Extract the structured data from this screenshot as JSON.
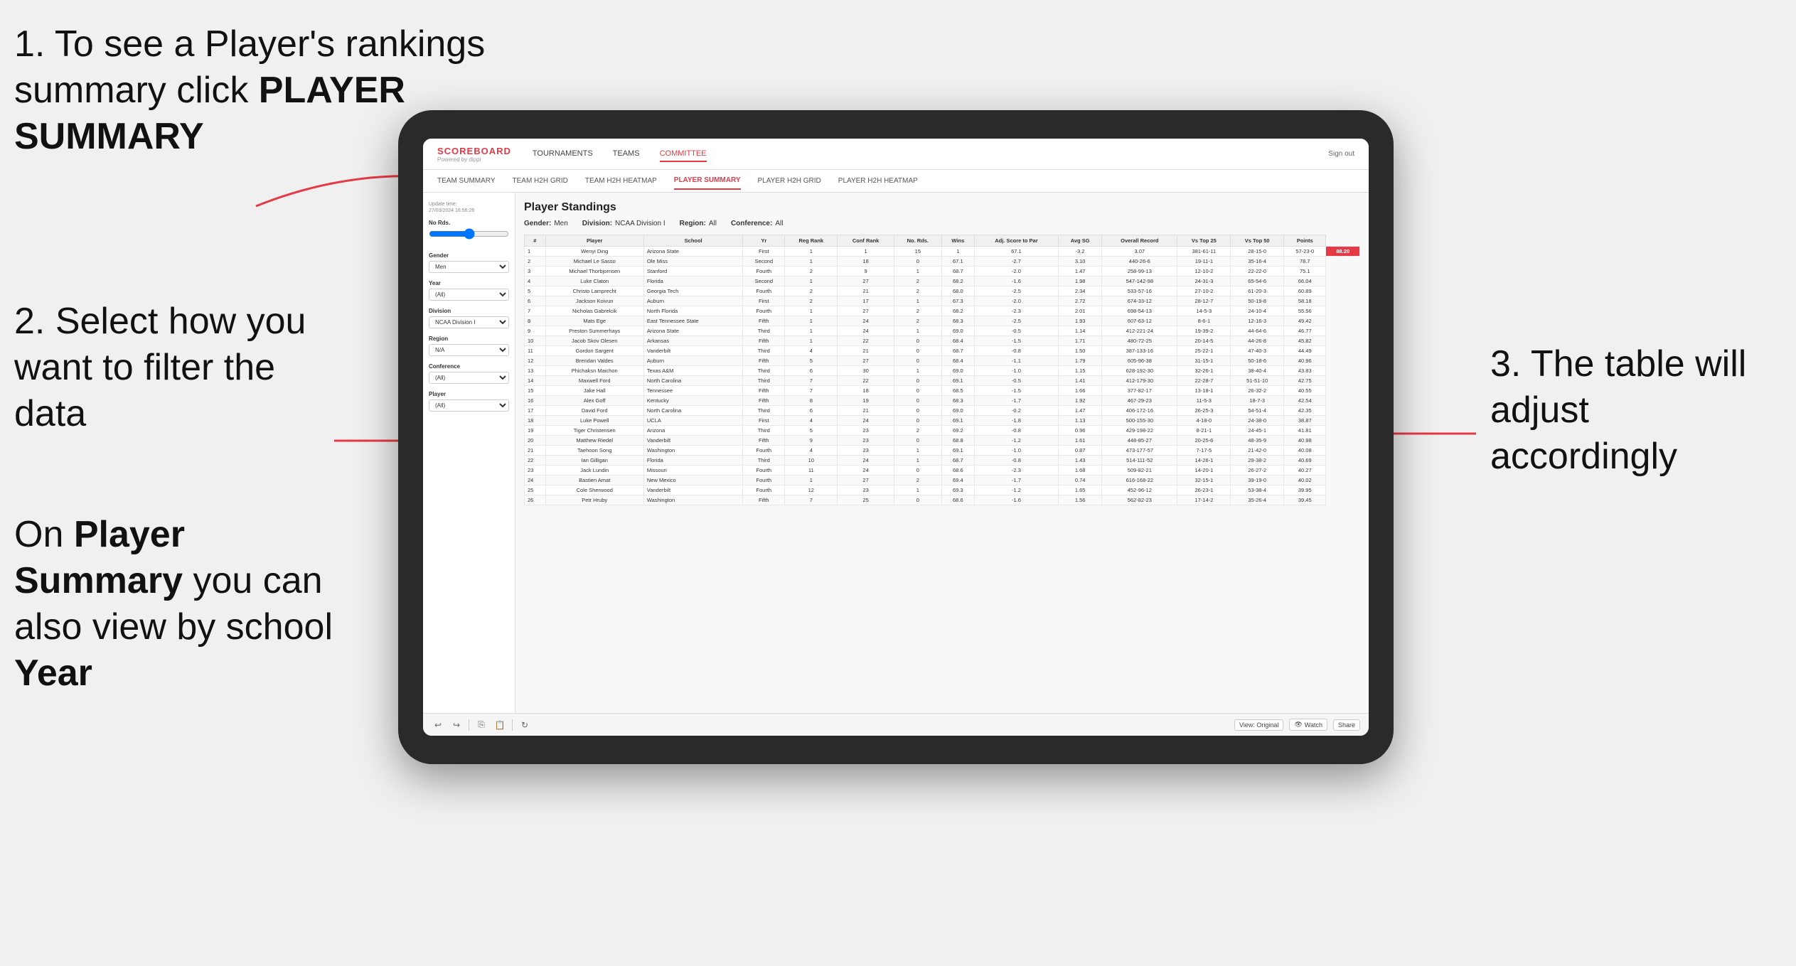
{
  "annotations": {
    "top_left_line1": "1. To see a Player's rankings",
    "top_left_line2": "summary click ",
    "top_left_bold": "PLAYER SUMMARY",
    "mid_left": "2. Select how you want to filter the data",
    "bottom_left_line1": "On ",
    "bottom_left_bold1": "Player Summary",
    "bottom_left_line2": " you can also view by school ",
    "bottom_left_bold2": "Year",
    "right_text": "3. The table will adjust accordingly"
  },
  "nav": {
    "logo": "SCOREBOARD",
    "logo_sub": "Powered by dippi",
    "items": [
      "TOURNAMENTS",
      "TEAMS",
      "COMMITTEE"
    ],
    "right": [
      "Sign out"
    ],
    "sub_items": [
      "TEAM SUMMARY",
      "TEAM H2H GRID",
      "TEAM H2H HEATMAP",
      "PLAYER SUMMARY",
      "PLAYER H2H GRID",
      "PLAYER H2H HEATMAP"
    ]
  },
  "sidebar": {
    "update_label": "Update time:",
    "update_time": "27/03/2024 16:56:26",
    "no_rds_label": "No Rds.",
    "slider_label": "",
    "gender_label": "Gender",
    "gender_value": "Men",
    "year_label": "Year",
    "year_value": "(All)",
    "division_label": "Division",
    "division_value": "NCAA Division I",
    "region_label": "Region",
    "region_value": "N/A",
    "conference_label": "Conference",
    "conference_value": "(All)",
    "player_label": "Player",
    "player_value": "(All)"
  },
  "table": {
    "title": "Player Standings",
    "filters": {
      "gender_label": "Gender:",
      "gender_value": "Men",
      "division_label": "Division:",
      "division_value": "NCAA Division I",
      "region_label": "Region:",
      "region_value": "All",
      "conference_label": "Conference:",
      "conference_value": "All"
    },
    "columns": [
      "#",
      "Player",
      "School",
      "Yr",
      "Reg Rank",
      "Conf Rank",
      "No. Rds.",
      "Wins",
      "Adj. Score to Par",
      "Avg SG",
      "Overall Record",
      "Vs Top 25",
      "Vs Top 50",
      "Points"
    ],
    "rows": [
      [
        "1",
        "Wenyi Ding",
        "Arizona State",
        "First",
        "1",
        "1",
        "15",
        "1",
        "67.1",
        "-3.2",
        "3.07",
        "381-61-11",
        "28-15-0",
        "57-23-0",
        "88.20"
      ],
      [
        "2",
        "Michael Le Sasso",
        "Ole Miss",
        "Second",
        "1",
        "18",
        "0",
        "67.1",
        "-2.7",
        "3.10",
        "440-26-6",
        "19-11-1",
        "35-16-4",
        "78.7"
      ],
      [
        "3",
        "Michael Thorbjornsen",
        "Stanford",
        "Fourth",
        "2",
        "9",
        "1",
        "68.7",
        "-2.0",
        "1.47",
        "258-99-13",
        "12-10-2",
        "22-22-0",
        "75.1"
      ],
      [
        "4",
        "Luke Claton",
        "Florida",
        "Second",
        "1",
        "27",
        "2",
        "68.2",
        "-1.6",
        "1.98",
        "547-142-98",
        "24-31-3",
        "65-54-6",
        "66.04"
      ],
      [
        "5",
        "Christo Lamprecht",
        "Georgia Tech",
        "Fourth",
        "2",
        "21",
        "2",
        "68.0",
        "-2.5",
        "2.34",
        "533-57-16",
        "27-10-2",
        "61-20-3",
        "60.89"
      ],
      [
        "6",
        "Jackson Koivun",
        "Auburn",
        "First",
        "2",
        "17",
        "1",
        "67.3",
        "-2.0",
        "2.72",
        "674-33-12",
        "28-12-7",
        "50-19-8",
        "58.18"
      ],
      [
        "7",
        "Nicholas Gabrelcik",
        "North Florida",
        "Fourth",
        "1",
        "27",
        "2",
        "68.2",
        "-2.3",
        "2.01",
        "698-54-13",
        "14-5-3",
        "24-10-4",
        "55.56"
      ],
      [
        "8",
        "Mats Ege",
        "East Tennessee State",
        "Fifth",
        "1",
        "24",
        "2",
        "68.3",
        "-2.5",
        "1.93",
        "607-63-12",
        "8-6-1",
        "12-16-3",
        "49.42"
      ],
      [
        "9",
        "Preston Summerhays",
        "Arizona State",
        "Third",
        "1",
        "24",
        "1",
        "69.0",
        "-0.5",
        "1.14",
        "412-221-24",
        "19-39-2",
        "44-64-6",
        "46.77"
      ],
      [
        "10",
        "Jacob Skov Olesen",
        "Arkansas",
        "Fifth",
        "1",
        "22",
        "0",
        "68.4",
        "-1.5",
        "1.71",
        "480-72-25",
        "20-14-5",
        "44-26-8",
        "45.82"
      ],
      [
        "11",
        "Gordon Sargent",
        "Vanderbilt",
        "Third",
        "4",
        "21",
        "0",
        "68.7",
        "-0.8",
        "1.50",
        "387-133-16",
        "25-22-1",
        "47-40-3",
        "44.49"
      ],
      [
        "12",
        "Brendan Valdes",
        "Auburn",
        "Fifth",
        "5",
        "27",
        "0",
        "68.4",
        "-1.1",
        "1.79",
        "605-96-38",
        "31-15-1",
        "50-18-6",
        "40.96"
      ],
      [
        "13",
        "Phichaksn Maichon",
        "Texas A&M",
        "Third",
        "6",
        "30",
        "1",
        "69.0",
        "-1.0",
        "1.15",
        "628-192-30",
        "32-26-1",
        "38-40-4",
        "43.83"
      ],
      [
        "14",
        "Maxwell Ford",
        "North Carolina",
        "Third",
        "7",
        "22",
        "0",
        "69.1",
        "-0.5",
        "1.41",
        "412-179-30",
        "22-28-7",
        "51-51-10",
        "42.75"
      ],
      [
        "15",
        "Jake Hall",
        "Tennessee",
        "Fifth",
        "7",
        "18",
        "0",
        "68.5",
        "-1.5",
        "1.66",
        "377-82-17",
        "13-18-1",
        "26-32-2",
        "40.55"
      ],
      [
        "16",
        "Alex Goff",
        "Kentucky",
        "Fifth",
        "8",
        "19",
        "0",
        "68.3",
        "-1.7",
        "1.92",
        "467-29-23",
        "11-5-3",
        "18-7-3",
        "42.54"
      ],
      [
        "17",
        "David Ford",
        "North Carolina",
        "Third",
        "6",
        "21",
        "0",
        "69.0",
        "-0.2",
        "1.47",
        "406-172-16",
        "26-25-3",
        "54-51-4",
        "42.35"
      ],
      [
        "18",
        "Luke Powell",
        "UCLA",
        "First",
        "4",
        "24",
        "0",
        "69.1",
        "-1.8",
        "1.13",
        "500-155-30",
        "4-18-0",
        "24-38-0",
        "38.87"
      ],
      [
        "19",
        "Tiger Christensen",
        "Arizona",
        "Third",
        "5",
        "23",
        "2",
        "69.2",
        "-0.8",
        "0.96",
        "429-198-22",
        "8-21-1",
        "24-45-1",
        "41.81"
      ],
      [
        "20",
        "Matthew Riedel",
        "Vanderbilt",
        "Fifth",
        "9",
        "23",
        "0",
        "68.8",
        "-1.2",
        "1.61",
        "448-85-27",
        "20-25-6",
        "48-35-9",
        "40.98"
      ],
      [
        "21",
        "Taehoon Song",
        "Washington",
        "Fourth",
        "4",
        "23",
        "1",
        "69.1",
        "-1.0",
        "0.87",
        "473-177-57",
        "7-17-5",
        "21-42-0",
        "40.08"
      ],
      [
        "22",
        "Ian Gilligan",
        "Florida",
        "Third",
        "10",
        "24",
        "1",
        "68.7",
        "-0.8",
        "1.43",
        "514-111-52",
        "14-26-1",
        "29-38-2",
        "40.69"
      ],
      [
        "23",
        "Jack Lundin",
        "Missouri",
        "Fourth",
        "11",
        "24",
        "0",
        "68.6",
        "-2.3",
        "1.68",
        "509-82-21",
        "14-20-1",
        "26-27-2",
        "40.27"
      ],
      [
        "24",
        "Bastien Amat",
        "New Mexico",
        "Fourth",
        "1",
        "27",
        "2",
        "69.4",
        "-1.7",
        "0.74",
        "616-168-22",
        "32-15-1",
        "39-19-0",
        "40.02"
      ],
      [
        "25",
        "Cole Sherwood",
        "Vanderbilt",
        "Fourth",
        "12",
        "23",
        "1",
        "69.3",
        "-1.2",
        "1.65",
        "452-96-12",
        "26-23-1",
        "53-38-4",
        "39.95"
      ],
      [
        "26",
        "Petr Hruby",
        "Washington",
        "Fifth",
        "7",
        "25",
        "0",
        "68.6",
        "-1.6",
        "1.56",
        "562-82-23",
        "17-14-2",
        "35-26-4",
        "39.45"
      ]
    ]
  },
  "toolbar": {
    "view_label": "View: Original",
    "watch_label": "Watch",
    "share_label": "Share"
  }
}
